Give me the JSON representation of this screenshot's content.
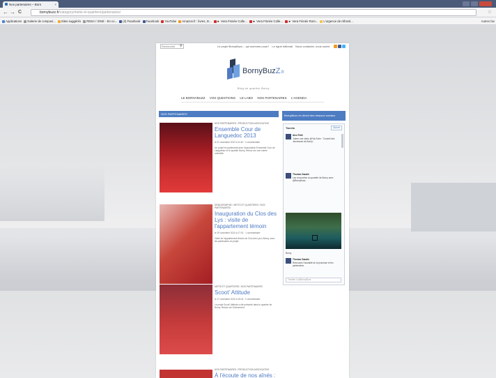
{
  "browser": {
    "tab_title": "Nos partenaires – Born",
    "tab_close": "×",
    "back": "←",
    "forward": "→",
    "reload": "C",
    "url_domain": "bornybuzz.fr",
    "url_path": "/category/metis-et-quartiers/partenaires/",
    "star": "☆",
    "bookmarks": [
      {
        "label": "Applications",
        "color": "#4a7fd1"
      },
      {
        "label": "Galerie de composi...",
        "color": "#999999"
      },
      {
        "label": "Sites suggérés",
        "color": "#f1a92d"
      },
      {
        "label": "RDSA / IOSE - En co...",
        "color": "#999999"
      },
      {
        "label": "(3) Facebook",
        "color": "#3b5998"
      },
      {
        "label": "Facebook",
        "color": "#3b5998"
      },
      {
        "label": "YouTube",
        "color": "#d22b2b"
      },
      {
        "label": "Amazon.fr : livres, D...",
        "color": "#f19a1c"
      },
      {
        "label": "► Vera Finnée Colle...",
        "color": "#d22b2b"
      },
      {
        "label": "► Vera Finnée Colle...",
        "color": "#d22b2b"
      },
      {
        "label": "► Vera Finnée Rom...",
        "color": "#d22b2b"
      },
      {
        "label": "L'urgence de réfonsl...",
        "color": "#f1c64a"
      }
    ],
    "bookmarks_other": "Autres fav"
  },
  "site": {
    "search_placeholder": "Recherche",
    "search_icon": "⚲",
    "toplinks": [
      "Le projet BornyBuzz... qui sommes-nous?",
      "Le rigné éditorial",
      "Nous contacter, nous suivre"
    ],
    "social_colors": [
      "#f19a1c",
      "#3b5998",
      "#4ab3f4"
    ],
    "logo_text": "BornyBuz",
    "logo_accent": "Z",
    "logo_tld": ".fr",
    "tagline": "Blog du quartier Borny",
    "nav": [
      "LE BORNYBUZZ",
      "VOS QUESTIONS",
      "LE LABO",
      "NOS PARTENAIRES",
      "L'AGENDA"
    ],
    "section_title": "NOS PARTENAIRES",
    "sidebar_title": "BornyBuzz en direct des réseaux sociaux"
  },
  "posts": [
    {
      "category": "NOS PARTENAIRES / PRODUCTION ASSOCIATIVE",
      "title": "Ensemble Cour de Languedoc 2013",
      "date": "le 21 novembre 2013 à 11:40 · 0 commentaire",
      "excerpt": "Un projet en partenariat avec l'association Ensemble Cour de Languedoc et le quartier Borny. Retour sur une soirée culturelle."
    },
    {
      "category": "DEMOGRAPHIE / METIS ET QUARTIERS / NOS PARTENAIRES",
      "title": "Inauguration du Clos des Lys : visite de l'appartement témoin",
      "date": "le 19 novembre 2013 à 17:01 · 1 commentaire",
      "excerpt": "Visite de l'appartement témoin du Clos des Lys à Borny, avec les partenaires du projet."
    },
    {
      "category": "METIS ET QUARTIERS / NOS PARTENAIRES",
      "title": "Scoot' Attitude",
      "date": "le 17 novembre 2013 à 15:41 · 0 commentaire",
      "excerpt": "Le projet Scoot' Attitude a été présenté dans le quartier de Borny. Retour sur l'événement."
    },
    {
      "category": "NOS PARTENAIRES / PRODUCTION ASSOCIATIVE",
      "title": "À l'écoute de nos aînés : les",
      "date": "",
      "excerpt": ""
    }
  ],
  "twitter": {
    "header": "Tweets",
    "follow_label": "Suivre",
    "tweets": [
      {
        "name": "Alex Petit",
        "body": "J'aime une vidéo @YouTube : 'Conseil des Jeunesses de Borny'."
      },
      {
        "name": "Thomas Gaudin",
        "body": "Les rencontres du quartier de Borny avec @BornyBuzz."
      },
      {
        "name": "Thomas Gaudin",
        "body": "Retrouvez l'actualité de la jeunesse et les partenaires."
      }
    ],
    "photo_caption": "Borny",
    "reply_placeholder": "Tweeter à @BornyBuzz"
  }
}
